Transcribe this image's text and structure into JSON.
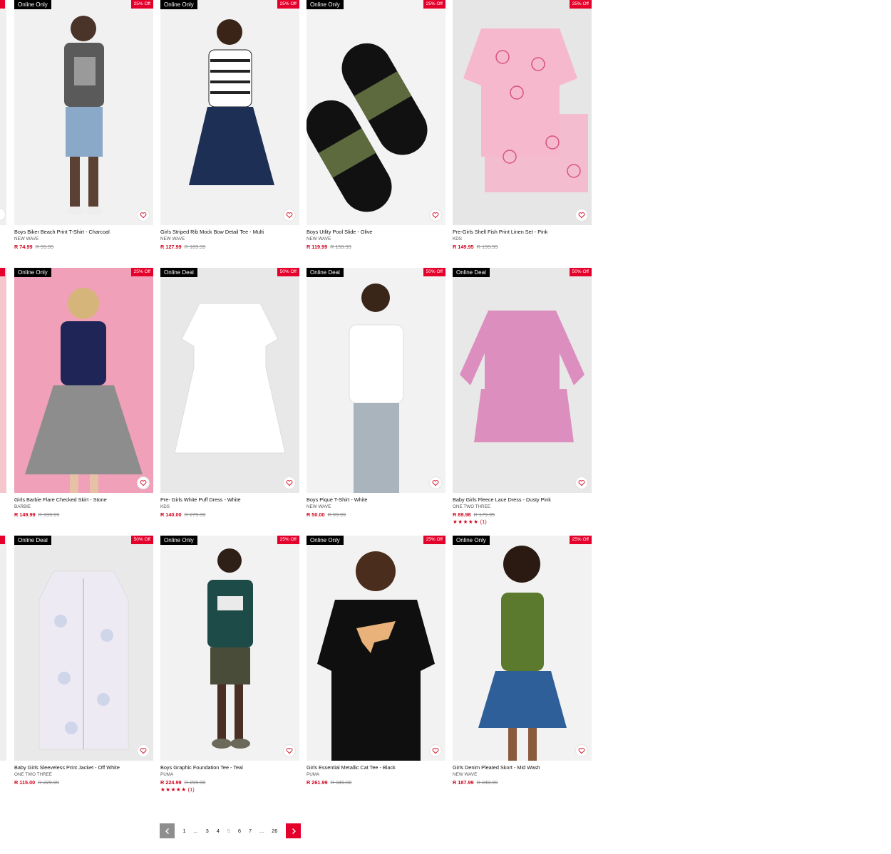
{
  "products": [
    {
      "title": "Boys Biker Beach Print T-Shirt - Charcoal",
      "brand": "NEW WAVE",
      "price": "R 74.99",
      "was": "R 99.99",
      "tag": "Online Only",
      "discount": "25% Off",
      "bg": "#f1f1f1"
    },
    {
      "title": "Girls Striped Rib Mock Bow Detail Tee - Multi",
      "brand": "NEW WAVE",
      "price": "R 127.99",
      "was": "R 169.99",
      "tag": "Online Only",
      "discount": "25% Off",
      "bg": "#f1f1f1"
    },
    {
      "title": "Boys Utlity Pool Slide - Olive",
      "brand": "NEW WAVE",
      "price": "R 119.99",
      "was": "R 159.99",
      "tag": "Online Only",
      "discount": "25% Off",
      "bg": "#f3f3f3"
    },
    {
      "title": "Pre-Girls Shell Fish Print Linen Set - Pink",
      "brand": "KDS",
      "price": "R 149.95",
      "was": "R 199.99",
      "tag": "",
      "discount": "25% Off",
      "bg": "#e6e6e6"
    },
    {
      "title": "Girls Barbie Flare Checked Skirt - Stone",
      "brand": "BARBIE",
      "price": "R 149.99",
      "was": "R 199.99",
      "tag": "Online Only",
      "discount": "25% Off",
      "bg": "#f0a0b8"
    },
    {
      "title": "Pre- Girls White Puff Dress - White",
      "brand": "KDS",
      "price": "R 140.00",
      "was": "R 279.99",
      "tag": "Online Deal",
      "discount": "50% Off",
      "bg": "#e8e8e8"
    },
    {
      "title": "Boys Pique T-Shirt - White",
      "brand": "NEW WAVE",
      "price": "R 50.00",
      "was": "R 99.99",
      "tag": "Online Deal",
      "discount": "50% Off",
      "bg": "#f2f2f2"
    },
    {
      "title": "Baby Girls Fleece Lace Dress - Dusty Pink",
      "brand": "ONE TWO THREE",
      "price": "R 89.98",
      "was": "R 179.95",
      "tag": "Online Deal",
      "discount": "50% Off",
      "bg": "#e8e8e8",
      "stars": "★★★★★",
      "reviews": "(1)"
    },
    {
      "title": "Baby Girls Sleeveless Print Jacket - Off White",
      "brand": "ONE TWO THREE",
      "price": "R 115.00",
      "was": "R 229.99",
      "tag": "Online Deal",
      "discount": "50% Off",
      "bg": "#e9e9e9"
    },
    {
      "title": "Boys Graphic Foundation Tee - Teal",
      "brand": "PUMA",
      "price": "R 224.99",
      "was": "R 299.99",
      "tag": "Online Only",
      "discount": "25% Off",
      "bg": "#f2f2f2",
      "stars": "★★★★★",
      "reviews": "(1)"
    },
    {
      "title": "Girls Essential Metallic Cat Tee - Black",
      "brand": "PUMA",
      "price": "R 261.99",
      "was": "R 349.00",
      "tag": "Online Only",
      "discount": "25% Off",
      "bg": "#f2f2f2"
    },
    {
      "title": "Girls Denim Pleated Skort - Mid Wash",
      "brand": "NEW WAVE",
      "price": "R 187.99",
      "was": "R 249.99",
      "tag": "Online Only",
      "discount": "25% Off",
      "bg": "#f2f2f2"
    }
  ],
  "pagination": {
    "pages": [
      "1",
      "...",
      "3",
      "4",
      "5",
      "6",
      "7",
      "...",
      "26"
    ],
    "current": "5"
  },
  "colors": {
    "accent": "#e4002b",
    "price": "#d0021b",
    "badge": "#000000"
  },
  "icons": {
    "wishlist": "heart-icon",
    "prev": "chevron-left-icon",
    "next": "chevron-right-icon"
  }
}
